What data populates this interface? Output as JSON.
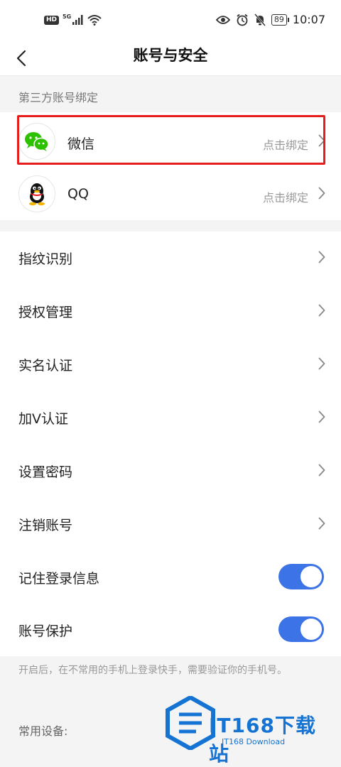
{
  "status_bar": {
    "hd": "HD",
    "network": "5G",
    "battery": "89",
    "time": "10:07"
  },
  "nav": {
    "title": "账号与安全"
  },
  "third_party": {
    "section_title": "第三方账号绑定",
    "items": [
      {
        "name": "微信",
        "action": "点击绑定",
        "icon": "wechat-icon"
      },
      {
        "name": "QQ",
        "action": "点击绑定",
        "icon": "qq-penguin-icon"
      }
    ]
  },
  "settings": {
    "items": [
      {
        "label": "指纹识别"
      },
      {
        "label": "授权管理"
      },
      {
        "label": "实名认证"
      },
      {
        "label": "加V认证"
      },
      {
        "label": "设置密码"
      },
      {
        "label": "注销账号"
      }
    ],
    "toggles": [
      {
        "label": "记住登录信息",
        "on": true
      },
      {
        "label": "账号保护",
        "on": true
      }
    ],
    "protection_note": "开启后，在不常用的手机上登录快手，需要验证你的手机号。",
    "devices_title": "常用设备:"
  },
  "colors": {
    "accent": "#3c73e6",
    "highlight": "#e51d1d",
    "wechat": "#2dc100"
  },
  "watermark": {
    "text": "IT168下载站",
    "sub": "IT168 Download"
  }
}
